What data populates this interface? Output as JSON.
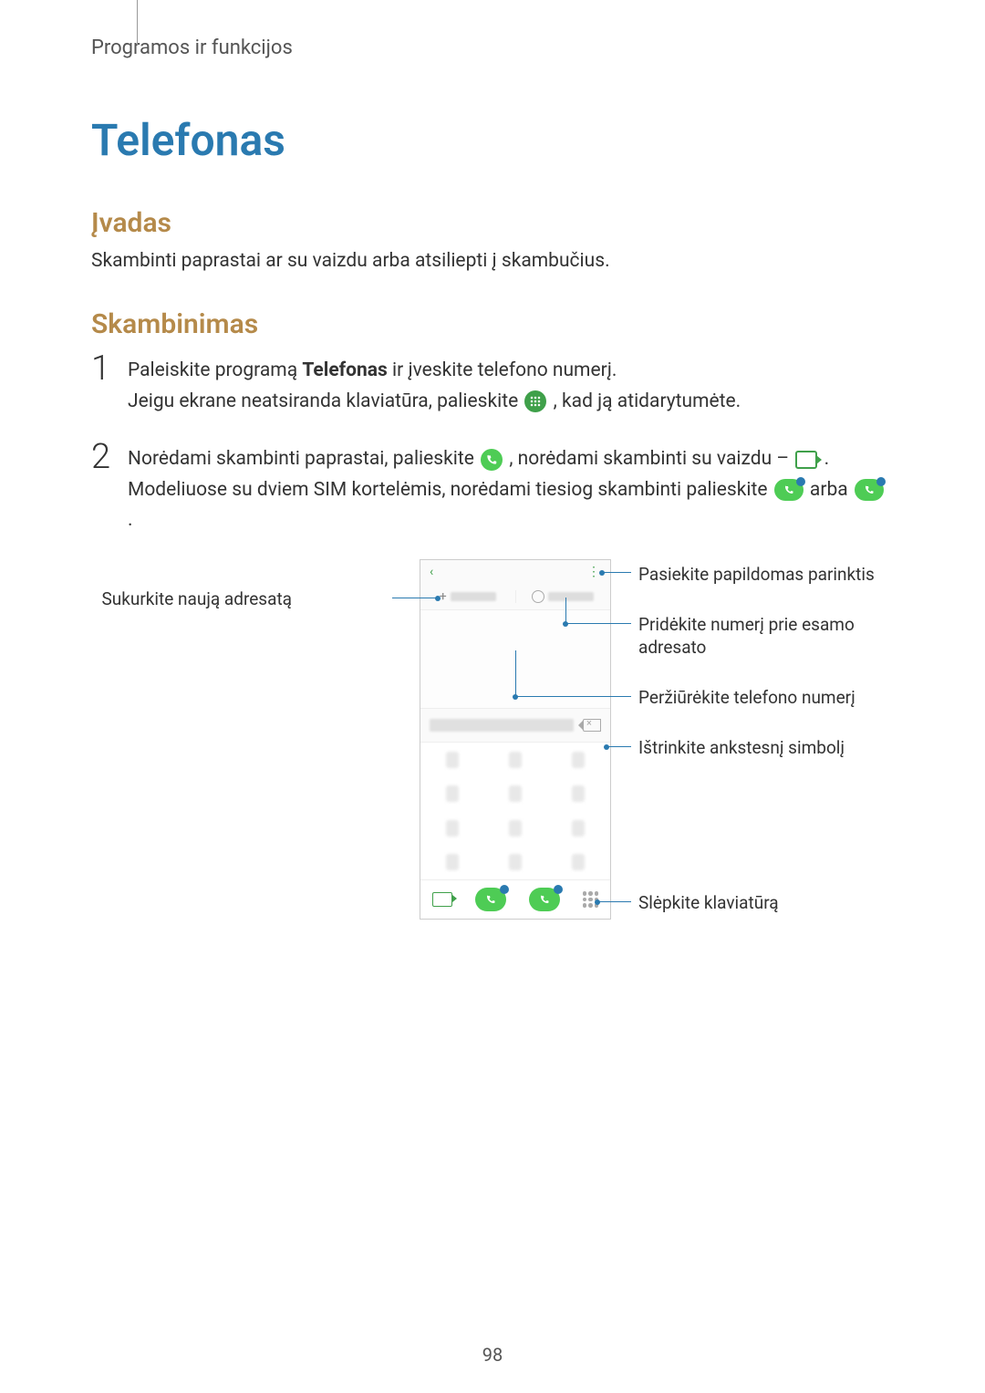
{
  "header": {
    "breadcrumb": "Programos ir funkcijos"
  },
  "title": "Telefonas",
  "section1": {
    "heading": "Įvadas",
    "text": "Skambinti paprastai ar su vaizdu arba atsiliepti į skambučius."
  },
  "section2": {
    "heading": "Skambinimas",
    "step1": {
      "num": "1",
      "pre": "Paleiskite programą ",
      "bold": "Telefonas",
      "post": " ir įveskite telefono numerį.",
      "line2a": "Jeigu ekrane neatsiranda klaviatūra, palieskite ",
      "line2b": ", kad ją atidarytumėte."
    },
    "step2": {
      "num": "2",
      "l1a": "Norėdami skambinti paprastai, palieskite ",
      "l1b": ", norėdami skambinti su vaizdu – ",
      "l1c": ".",
      "l2a": "Modeliuose su dviem SIM kortelėmis, norėdami tiesiog skambinti palieskite ",
      "l2b": " arba ",
      "l2c": "."
    }
  },
  "callouts": {
    "new_contact": "Sukurkite naują adresatą",
    "more_options": "Pasiekite papildomas parinktis",
    "add_to_contact": "Pridėkite numerį prie esamo adresato",
    "preview_number": "Peržiūrėkite telefono numerį",
    "delete_char": "Ištrinkite ankstesnį simbolį",
    "hide_keypad": "Slėpkite klaviatūrą"
  },
  "page_number": "98"
}
